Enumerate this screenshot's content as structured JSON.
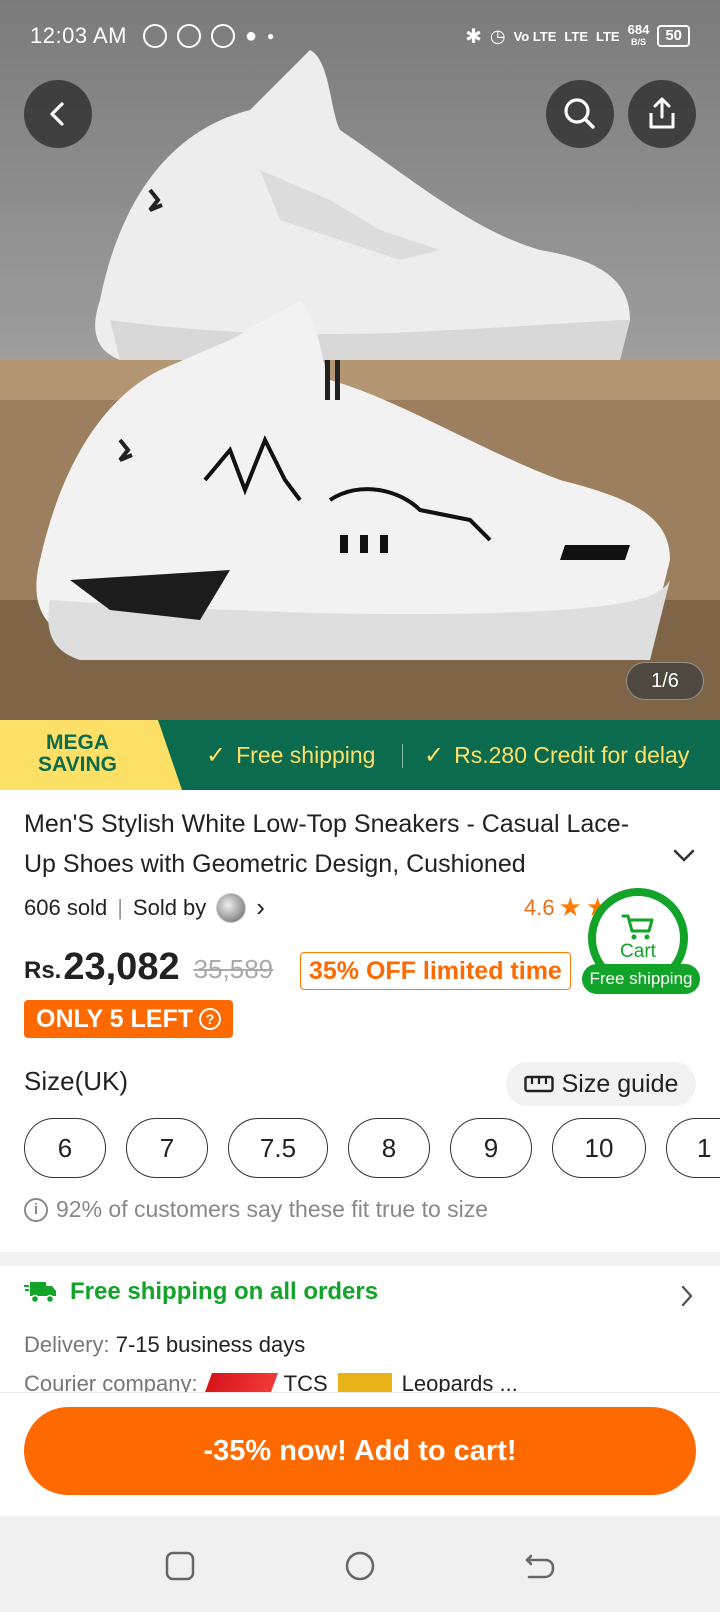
{
  "status_bar": {
    "time": "12:03 AM",
    "network_speed": "684",
    "network_unit": "B/S",
    "battery": "50",
    "signal_labels": [
      "Vo LTE",
      "LTE",
      "LTE"
    ]
  },
  "hero": {
    "image_counter": "1/6",
    "back_icon": "chevron-left-icon",
    "search_icon": "search-icon",
    "share_icon": "share-icon"
  },
  "promo": {
    "mega_line1": "MEGA",
    "mega_line2": "SAVING",
    "item1": "Free shipping",
    "item2": "Rs.280 Credit for delay",
    "bg_color": "#0b6b4f",
    "text_color": "#ffe066"
  },
  "product": {
    "title": "Men'S Stylish White Low-Top Sneakers - Casual Lace-Up Shoes with Geometric Design, Cushioned",
    "sold": "606 sold",
    "sold_by": "Sold by",
    "rating": "4.6",
    "price_currency": "Rs.",
    "price": "23,082",
    "old_price": "35,589",
    "discount_tag": "35% OFF limited time",
    "stock_badge": "ONLY 5 LEFT",
    "accent_color": "#ff6a00"
  },
  "cart_badge": {
    "label": "Cart",
    "pill": "Free shipping",
    "color": "#12a329"
  },
  "size": {
    "label": "Size(UK)",
    "guide": "Size guide",
    "options": [
      "6",
      "7",
      "7.5",
      "8",
      "9",
      "10",
      "1"
    ],
    "fit_note": "92% of customers say these fit true to size"
  },
  "shipping": {
    "title": "Free shipping on all orders",
    "delivery_label": "Delivery:",
    "delivery_value": "7-15 business days",
    "courier_label": "Courier company:",
    "courier1": "TCS",
    "courier2": "Leopards ..."
  },
  "cta": {
    "label": "-35% now! Add to cart!"
  }
}
